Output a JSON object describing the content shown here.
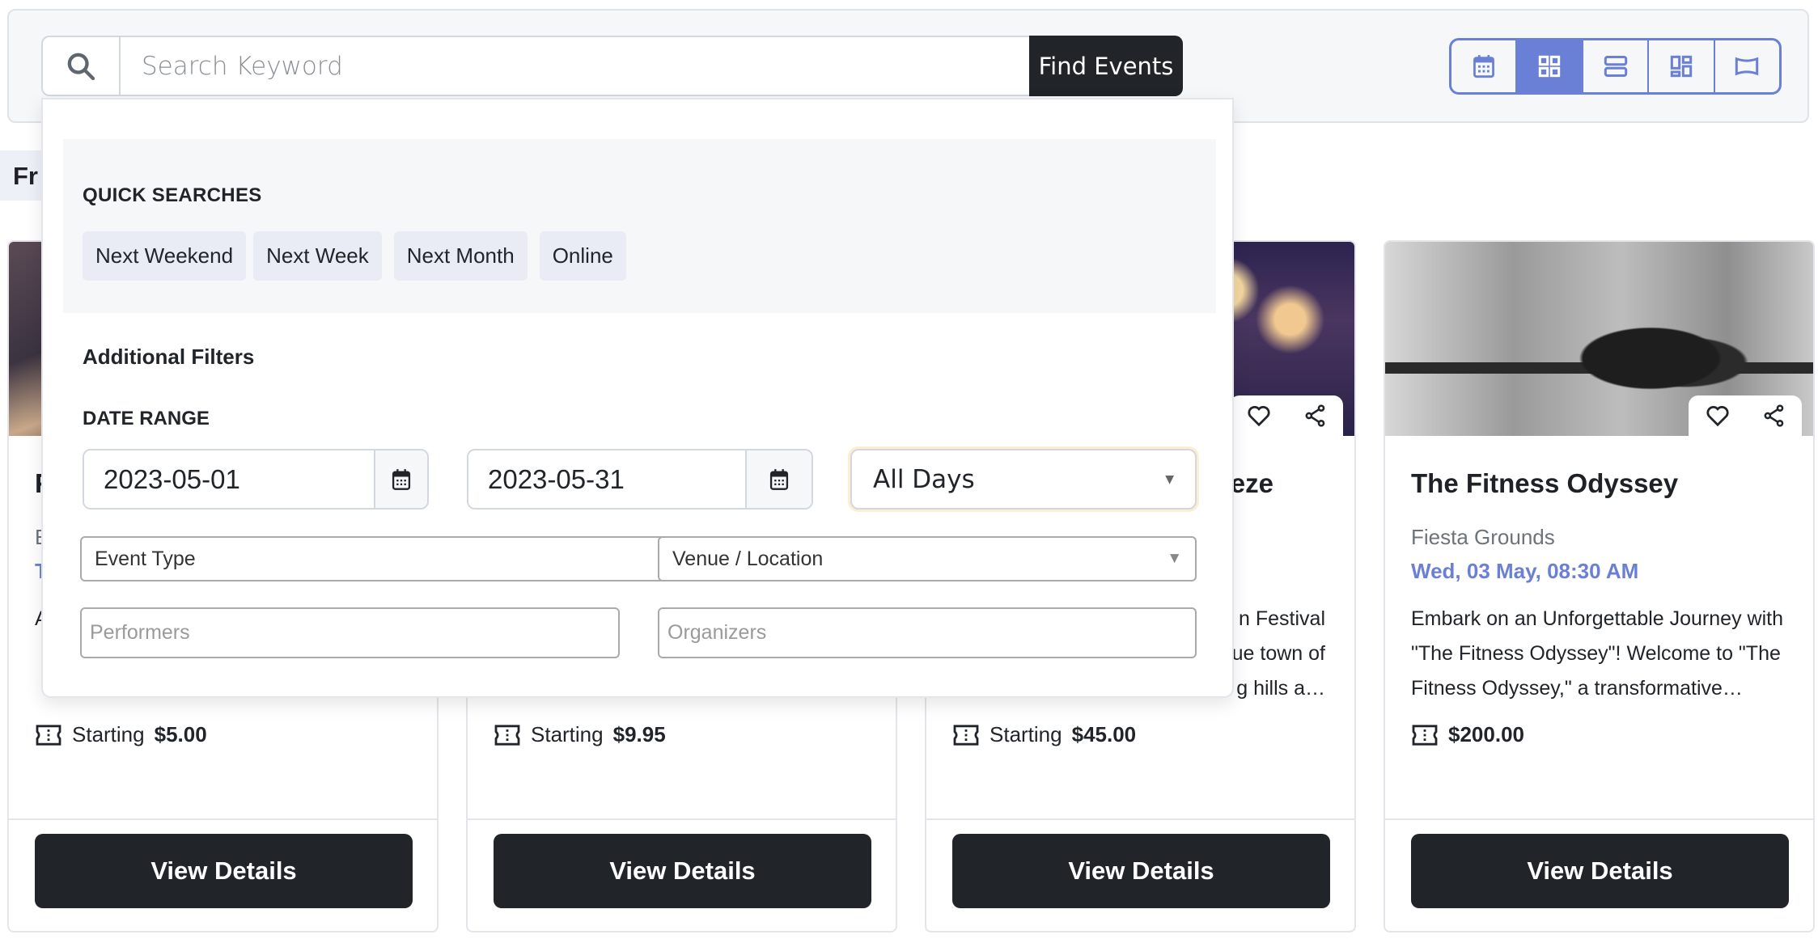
{
  "search": {
    "placeholder": "Search Keyword",
    "value": "",
    "submit_label": "Find Events",
    "icon": "search-icon"
  },
  "view_toggle": {
    "active_index": 1,
    "items": [
      {
        "name": "calendar-view",
        "icon": "calendar-icon"
      },
      {
        "name": "grid-view",
        "icon": "grid-icon"
      },
      {
        "name": "list-view",
        "icon": "list-icon"
      },
      {
        "name": "masonry-view",
        "icon": "masonry-icon"
      },
      {
        "name": "slider-view",
        "icon": "slider-icon"
      }
    ]
  },
  "featured_tab": {
    "label": "Fr"
  },
  "filter_panel": {
    "quick_searches_title": "QUICK SEARCHES",
    "quick_searches": [
      "Next Weekend",
      "Next Week",
      "Next Month",
      "Online"
    ],
    "additional_filters_title": "Additional Filters",
    "date_range_label": "DATE RANGE",
    "start_date": "2023-05-01",
    "end_date": "2023-05-31",
    "days_select": "All Days",
    "event_type": "Event Type",
    "venue": "Venue / Location",
    "performers_placeholder": "Performers",
    "organizers_placeholder": "Organizers"
  },
  "events": [
    {
      "title": "F",
      "venue": "E",
      "date": "T",
      "description": "A r c",
      "price_prefix": "Starting",
      "price": "$5.00",
      "button": "View Details"
    },
    {
      "title": "",
      "venue": "",
      "date": "",
      "description": "",
      "price_prefix": "Starting",
      "price": "$9.95",
      "button": "View Details"
    },
    {
      "title": "eze",
      "venue": "",
      "date": "",
      "description": "n Festival ue town of g hills a…",
      "price_prefix": "Starting",
      "price": "$45.00",
      "button": "View Details"
    },
    {
      "title": "The Fitness Odyssey",
      "venue": "Fiesta Grounds",
      "date": "Wed, 03 May, 08:30 AM",
      "description": "Embark on an Unforgettable Journey with \"The Fitness Odyssey\"! Welcome to \"The Fitness Odyssey,\" a transformative…",
      "price_prefix": "",
      "price": "$200.00",
      "button": "View Details"
    }
  ],
  "colors": {
    "accent": "#6a80d6",
    "dark_button": "#212529",
    "chip_bg": "#e9ebf5",
    "panel_gray": "#f6f7f9"
  }
}
